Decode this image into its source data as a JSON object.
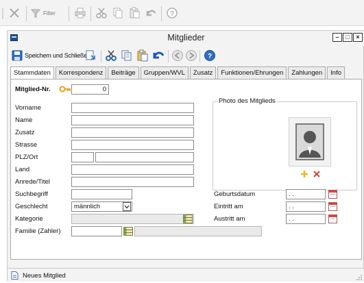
{
  "top_toolbar": {
    "filter_label": "Filter",
    "icons": [
      "close-icon",
      "filter-icon",
      "print-icon",
      "cut-icon",
      "copy-icon",
      "paste-icon",
      "undo-icon",
      "help-icon"
    ]
  },
  "window": {
    "title": "Mitglieder",
    "buttons": [
      "minimize-icon",
      "maximize-icon",
      "close-icon"
    ]
  },
  "window_toolbar": {
    "save_label": "Speichern und Schließen",
    "icons": [
      "save-icon",
      "print-icon",
      "cut-icon",
      "copy-icon",
      "paste-icon",
      "undo-icon",
      "back-icon",
      "forward-icon",
      "help-icon"
    ]
  },
  "tabs": [
    {
      "label": "Stammdaten",
      "active": true
    },
    {
      "label": "Korrespondenz",
      "active": false
    },
    {
      "label": "Beiträge",
      "active": false
    },
    {
      "label": "Gruppen/WVL",
      "active": false
    },
    {
      "label": "Zusatz",
      "active": false
    },
    {
      "label": "Funktionen/Ehrungen",
      "active": false
    },
    {
      "label": "Zahlungen",
      "active": false
    },
    {
      "label": "Info",
      "active": false
    }
  ],
  "form": {
    "member_no_label": "Mitglied-Nr.",
    "member_no_value": "0",
    "first_name_label": "Vorname",
    "first_name_value": "",
    "last_name_label": "Name",
    "last_name_value": "",
    "addition_label": "Zusatz",
    "addition_value": "",
    "street_label": "Strasse",
    "street_value": "",
    "zip_city_label": "PLZ/Ort",
    "zip_value": "",
    "city_value": "",
    "country_label": "Land",
    "country_value": "",
    "salutation_label": "Anrede/Titel",
    "salutation_value": "",
    "search_term_label": "Suchbegriff",
    "search_term_value": "",
    "gender_label": "Geschlecht",
    "gender_value": "männlich",
    "category_label": "Kategorie",
    "category_value": "",
    "family_label": "Familie (Zahler)",
    "family_value": ""
  },
  "photo": {
    "legend": "Photo des Mitglieds",
    "icons": [
      "avatar-icon",
      "add-icon",
      "delete-icon"
    ]
  },
  "dates": {
    "birth_label": "Geburtsdatum",
    "birth_value": ". .",
    "entry_label": "Eintritt am",
    "entry_value": ". .",
    "exit_label": "Austritt am",
    "exit_value": ". ."
  },
  "status_bar": {
    "text": "Neues Mitglied"
  },
  "colors": {
    "accent_blue": "#1e6fc8",
    "key_orange": "#e9a019",
    "delete_red": "#e03a2e",
    "add_yellow": "#f2b51c"
  }
}
